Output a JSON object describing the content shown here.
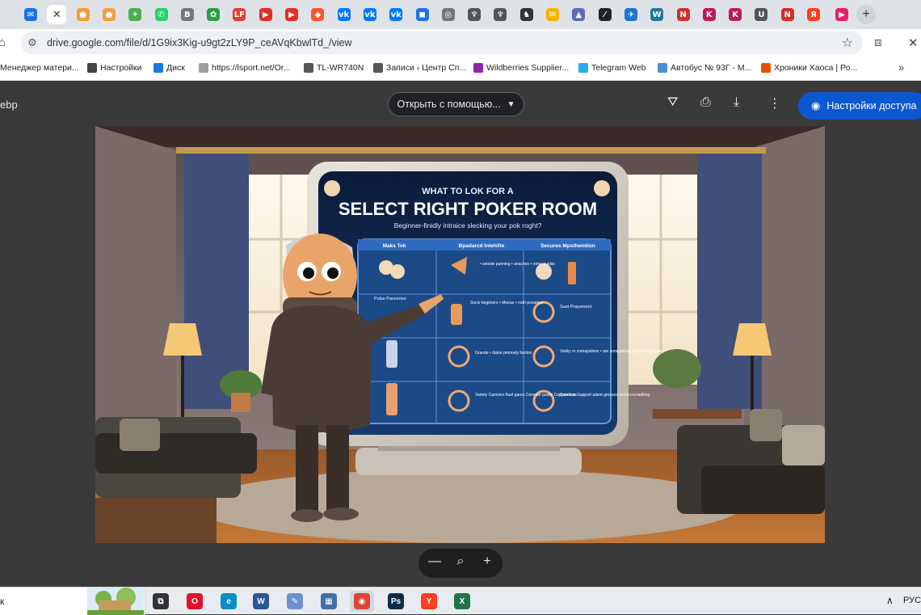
{
  "tabs": [
    {
      "icon": "outlook-mail-icon",
      "glyph": "✉",
      "color": "#1a73e8"
    },
    {
      "icon": "close-tab-icon",
      "glyph": "✕",
      "color": "#ffffff",
      "active": true
    },
    {
      "icon": "orange-dot-icon",
      "glyph": "●",
      "color": "#f59e3b"
    },
    {
      "icon": "orange-dot-icon",
      "glyph": "●",
      "color": "#f59e3b"
    },
    {
      "icon": "map-pin-icon",
      "glyph": "✦",
      "color": "#4caf50"
    },
    {
      "icon": "whatsapp-icon",
      "glyph": "✆",
      "color": "#25d366"
    },
    {
      "icon": "bitcoin-icon",
      "glyph": "B",
      "color": "#777777"
    },
    {
      "icon": "green-swirl-icon",
      "glyph": "✿",
      "color": "#2e9e48"
    },
    {
      "icon": "lf-icon",
      "glyph": "LF",
      "color": "#e53935"
    },
    {
      "icon": "youtube-icon",
      "glyph": "▶",
      "color": "#e52d27"
    },
    {
      "icon": "youtube-icon",
      "glyph": "▶",
      "color": "#e52d27"
    },
    {
      "icon": "brave-icon",
      "glyph": "◆",
      "color": "#fb542b"
    },
    {
      "icon": "vk-icon",
      "glyph": "vk",
      "color": "#0077ff"
    },
    {
      "icon": "vk-icon",
      "glyph": "vk",
      "color": "#0077ff"
    },
    {
      "icon": "vk-icon",
      "glyph": "vk",
      "color": "#0077ff"
    },
    {
      "icon": "chat-icon",
      "glyph": "◼",
      "color": "#1a73e8"
    },
    {
      "icon": "globe-icon",
      "glyph": "◎",
      "color": "#777777"
    },
    {
      "icon": "trophy-icon",
      "glyph": "♆",
      "color": "#555555"
    },
    {
      "icon": "trophy-icon",
      "glyph": "♆",
      "color": "#555555"
    },
    {
      "icon": "figure-icon",
      "glyph": "♞",
      "color": "#333333"
    },
    {
      "icon": "mail-envelope-icon",
      "glyph": "✉",
      "color": "#f4b400"
    },
    {
      "icon": "triangle-icon",
      "glyph": "▲",
      "color": "#5c6bc0"
    },
    {
      "icon": "slash-icon",
      "glyph": "⁄",
      "color": "#222222"
    },
    {
      "icon": "plane-icon",
      "glyph": "✈",
      "color": "#1976d2"
    },
    {
      "icon": "wordpress-icon",
      "glyph": "W",
      "color": "#21759b"
    },
    {
      "icon": "n-icon",
      "glyph": "N",
      "color": "#d32f2f"
    },
    {
      "icon": "k-icon",
      "glyph": "K",
      "color": "#c2185b"
    },
    {
      "icon": "k-icon",
      "glyph": "K",
      "color": "#c2185b"
    },
    {
      "icon": "u-icon",
      "glyph": "U",
      "color": "#555555"
    },
    {
      "icon": "n-icon",
      "glyph": "N",
      "color": "#d32f2f"
    },
    {
      "icon": "yandex-icon",
      "glyph": "Я",
      "color": "#fc3f1d"
    },
    {
      "icon": "red-play-icon",
      "glyph": "▶",
      "color": "#e91e63"
    }
  ],
  "address_bar": {
    "url": "drive.google.com/file/d/1G9ix3Kig-u9gt2zLY9P_ceAVqKbwlTd_/view"
  },
  "bookmarks": [
    {
      "label": "Менеджер матери...",
      "icon": "none",
      "color": "#ffffff"
    },
    {
      "label": "Настройки",
      "icon": "gear-icon",
      "color": "#444444"
    },
    {
      "label": "Диск",
      "icon": "disk-icon",
      "color": "#1a73e8"
    },
    {
      "label": "https://lsport.net/Or...",
      "icon": "page-icon",
      "color": "#9e9e9e"
    },
    {
      "label": "TL-WR740N",
      "icon": "globe-icon",
      "color": "#555555"
    },
    {
      "label": "Записи ‹ Центр Сп...",
      "icon": "trophy-icon",
      "color": "#555555"
    },
    {
      "label": "Wildberries Supplier...",
      "icon": "wildberries-icon",
      "color": "#8e24aa"
    },
    {
      "label": "Telegram Web",
      "icon": "telegram-icon",
      "color": "#2aabee"
    },
    {
      "label": "Автобус № 93Г - М...",
      "icon": "bus-icon",
      "color": "#4a90d9"
    },
    {
      "label": "Хроники Хаоса | Ро...",
      "icon": "flame-icon",
      "color": "#e65100"
    }
  ],
  "viewer": {
    "filename_fragment": "ebp",
    "open_with_label": "Открыть с помощью...",
    "share_label": "Настройки доступа"
  },
  "image": {
    "title_small": "WHAT TO LOK FOR A",
    "title_big": "SELECT RIGHT POKER ROOM",
    "subtitle": "Beginner-finidly intraice slecking your pok roght?",
    "column_headers": [
      "Maks Tek",
      "Bpadarcd Intehlite",
      "Secures Mpsthemtion"
    ],
    "cells": [
      [
        "",
        "• wessle panning\n• anaches\n• roma puelss",
        ""
      ],
      [
        "Pulse Pavvenes",
        "Socio begimers\n• dhoras\n• rnah povamse",
        "Suet\nPraysment"
      ],
      [
        "",
        "Grande\n• dame pmonely\nfuntion",
        "Variky or\ncomapulives\n• are sompalmsal\ncrwen le as grites"
      ],
      [
        "",
        "Variety Camvers\nfluet gares\nCommer pawle\nCoppenduce",
        "Cutstone Support\nadent gresses\nrevnd covraditing"
      ]
    ]
  },
  "zoom_controls": {
    "minus": "—",
    "reset": "⌕",
    "plus": "+"
  },
  "taskbar": {
    "search_text": "к",
    "apps": [
      {
        "icon": "task-view-icon",
        "glyph": "⧉",
        "color": "#333333"
      },
      {
        "icon": "opera-icon",
        "glyph": "O",
        "color": "#e3102b"
      },
      {
        "icon": "edge-icon",
        "glyph": "e",
        "color": "#0c8ecb"
      },
      {
        "icon": "word-icon",
        "glyph": "W",
        "color": "#2b579a"
      },
      {
        "icon": "paint-icon",
        "glyph": "✎",
        "color": "#6d8fcf"
      },
      {
        "icon": "calculator-icon",
        "glyph": "▦",
        "color": "#3f6ea8"
      },
      {
        "icon": "chrome-icon",
        "glyph": "◉",
        "color": "#db4437",
        "active": true
      },
      {
        "icon": "photoshop-icon",
        "glyph": "Ps",
        "color": "#0b2b4b"
      },
      {
        "icon": "yandex-browser-icon",
        "glyph": "Y",
        "color": "#fc3f1d"
      },
      {
        "icon": "excel-icon",
        "glyph": "X",
        "color": "#217346"
      }
    ],
    "lang": "РУС"
  }
}
